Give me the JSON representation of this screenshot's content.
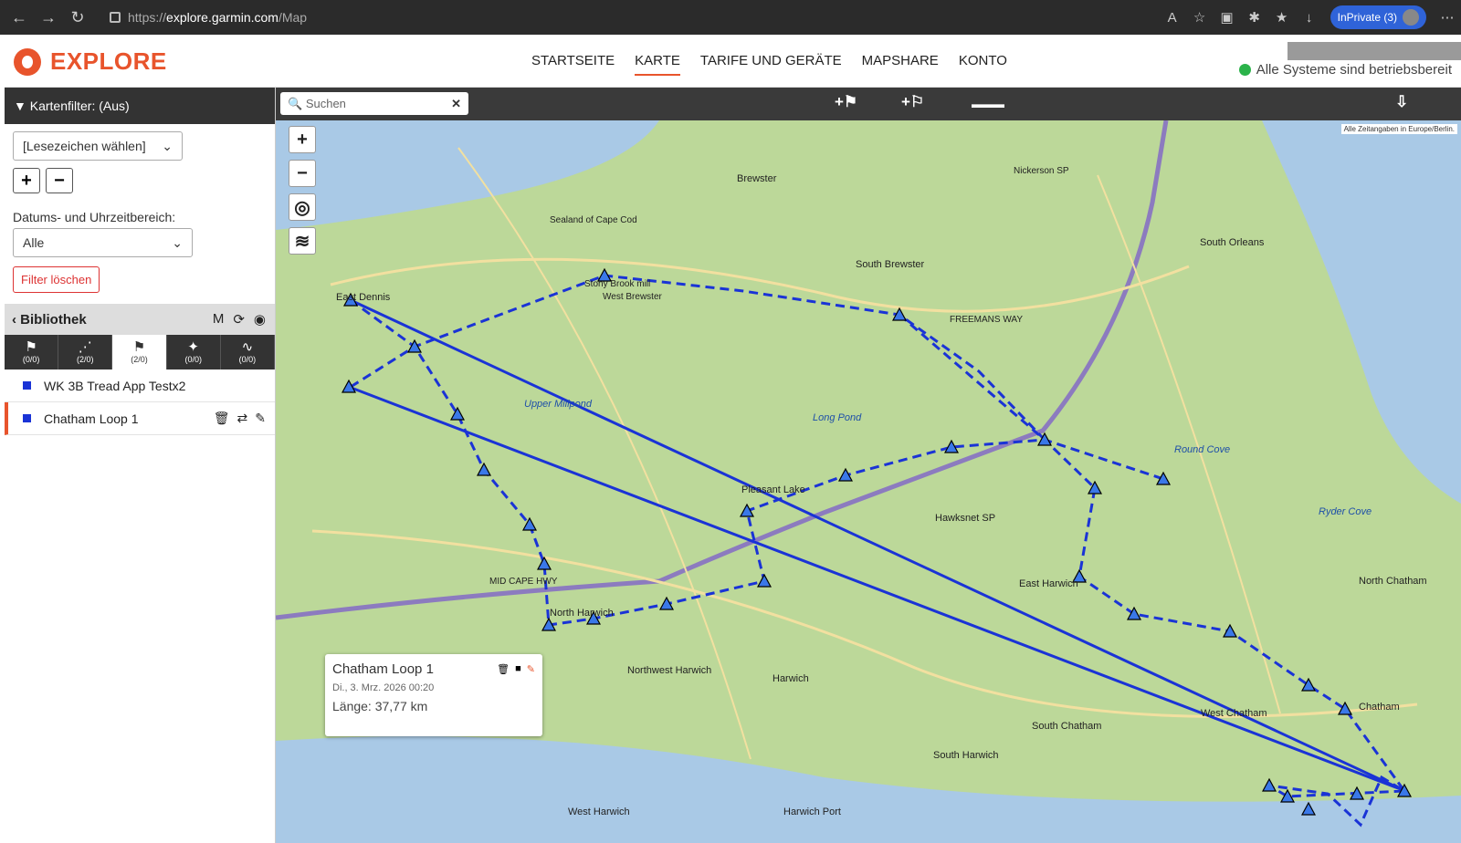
{
  "browser": {
    "url_prefix": "https://",
    "url_host": "explore.garmin.com",
    "url_path": "/Map",
    "inprivate_label": "InPrivate (3)"
  },
  "header": {
    "logo_text": "EXPLORE",
    "nav": [
      "STARTSEITE",
      "KARTE",
      "TARIFE UND GERÄTE",
      "MAPSHARE",
      "KONTO"
    ],
    "active_nav": "KARTE",
    "status_text": "Alle Systeme sind betriebsbereit"
  },
  "sidebar": {
    "filter_title": "▼ Kartenfilter: (Aus)",
    "bookmark_select": "[Lesezeichen wählen]",
    "date_label": "Datums- und Uhrzeitbereich:",
    "date_select": "Alle",
    "clear_filter": "Filter löschen",
    "library_title": "Bibliothek",
    "tabs": [
      {
        "icon": "⚑",
        "count": "(0/0)"
      },
      {
        "icon": "⋰",
        "count": "(2/0)"
      },
      {
        "icon": "⚑",
        "count": "(2/0)"
      },
      {
        "icon": "✦",
        "count": "(0/0)"
      },
      {
        "icon": "∿",
        "count": "(0/0)"
      }
    ],
    "items": [
      {
        "name": "WK 3B Tread App Testx2"
      },
      {
        "name": "Chatham Loop 1"
      }
    ]
  },
  "map": {
    "search_placeholder": "Suchen",
    "timezone_note": "Alle Zeitangaben in Europe/Berlin.",
    "popup": {
      "title": "Chatham Loop 1",
      "date": "Di., 3. Mrz. 2026 00:20",
      "length": "Länge: 37,77 km"
    },
    "labels": [
      {
        "text": "East Dennis"
      },
      {
        "text": "Brewster"
      },
      {
        "text": "South Brewster"
      },
      {
        "text": "South Orleans"
      },
      {
        "text": "Pleasant Lake"
      },
      {
        "text": "Hawksnet SP"
      },
      {
        "text": "North Harwich"
      },
      {
        "text": "Northwest Harwich"
      },
      {
        "text": "Harwich"
      },
      {
        "text": "East Harwich"
      },
      {
        "text": "South Chatham"
      },
      {
        "text": "South Harwich"
      },
      {
        "text": "West Chatham"
      },
      {
        "text": "Chatham"
      },
      {
        "text": "North Chatham"
      },
      {
        "text": "West Harwich"
      },
      {
        "text": "Harwich Port"
      },
      {
        "text": "Long Pond"
      },
      {
        "text": "Upper Millpond"
      },
      {
        "text": "Round Cove"
      },
      {
        "text": "Ryder Cove"
      },
      {
        "text": "MID CAPE HWY"
      },
      {
        "text": "FREEMANS WAY"
      },
      {
        "text": "Nickerson SP"
      },
      {
        "text": "Sealand of Cape Cod"
      },
      {
        "text": "Stony Brook mill"
      },
      {
        "text": "West Brewster"
      }
    ]
  },
  "colors": {
    "accent": "#e8542c",
    "route": "#1a33d6",
    "status_ok": "#2bb34a"
  }
}
